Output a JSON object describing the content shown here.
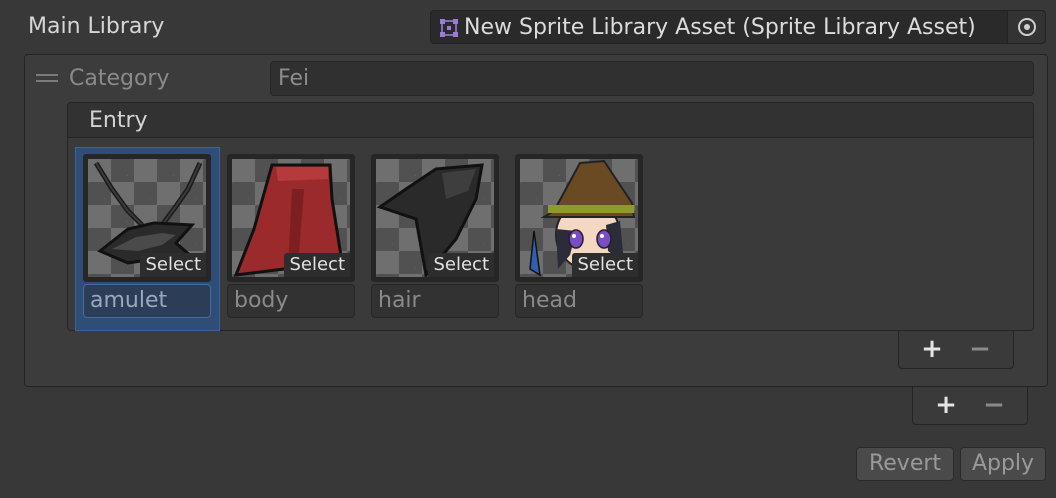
{
  "main_library": {
    "label": "Main Library",
    "asset_value": "New Sprite Library Asset (Sprite Library Asset)",
    "asset_icon": "sprite-library-icon",
    "picker_icon": "object-picker-icon"
  },
  "category": {
    "label": "Category",
    "value": "Fei",
    "handle_icon": "drag-handle-icon"
  },
  "entry": {
    "header": "Entry",
    "items": [
      {
        "name": "amulet",
        "select_label": "Select",
        "selected": true
      },
      {
        "name": "body",
        "select_label": "Select",
        "selected": false
      },
      {
        "name": "hair",
        "select_label": "Select",
        "selected": false
      },
      {
        "name": "head",
        "select_label": "Select",
        "selected": false
      }
    ]
  },
  "entry_list_controls": {
    "add": "+",
    "remove": "−"
  },
  "category_list_controls": {
    "add": "+",
    "remove": "−"
  },
  "actions": {
    "revert": "Revert",
    "apply": "Apply"
  },
  "colors": {
    "selection": "#2e4e78",
    "background": "#383838",
    "asset_icon": "#8f6bd6"
  }
}
